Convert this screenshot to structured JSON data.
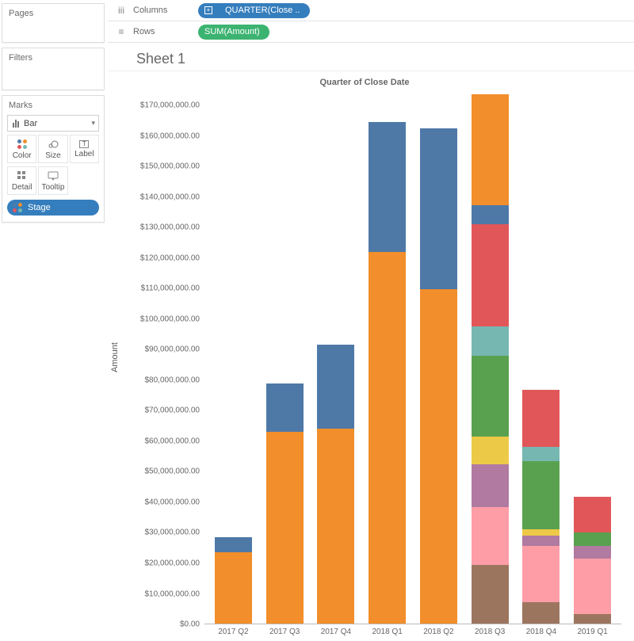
{
  "left": {
    "pages_title": "Pages",
    "filters_title": "Filters",
    "marks_title": "Marks",
    "mark_type": "Bar",
    "mark_cells": {
      "color": "Color",
      "size": "Size",
      "label": "Label",
      "detail": "Detail",
      "tooltip": "Tooltip"
    },
    "stage_pill": "Stage"
  },
  "shelves": {
    "columns_label": "Columns",
    "rows_label": "Rows",
    "column_pill": "QUARTER(Close ..",
    "row_pill": "SUM(Amount)"
  },
  "sheet_title": "Sheet 1",
  "chart_data": {
    "type": "bar",
    "stacked": true,
    "title": "Quarter of Close Date",
    "ylabel": "Amount",
    "ylim": [
      0,
      175000000
    ],
    "y_ticks": [
      "$170,000,000.00",
      "$160,000,000.00",
      "$150,000,000.00",
      "$140,000,000.00",
      "$130,000,000.00",
      "$120,000,000.00",
      "$110,000,000.00",
      "$100,000,000.00",
      "$90,000,000.00",
      "$80,000,000.00",
      "$70,000,000.00",
      "$60,000,000.00",
      "$50,000,000.00",
      "$40,000,000.00",
      "$30,000,000.00",
      "$20,000,000.00",
      "$10,000,000.00",
      "$0.00"
    ],
    "y_tick_values": [
      170000000,
      160000000,
      150000000,
      140000000,
      130000000,
      120000000,
      110000000,
      100000000,
      90000000,
      80000000,
      70000000,
      60000000,
      50000000,
      40000000,
      30000000,
      20000000,
      10000000,
      0
    ],
    "categories": [
      "2017 Q2",
      "2017 Q3",
      "2017 Q4",
      "2018 Q1",
      "2018 Q2",
      "2018 Q3",
      "2018 Q4",
      "2019 Q1"
    ],
    "colors": {
      "orange": "#f28e2b",
      "blue": "#4e79a7",
      "red": "#e15759",
      "teal": "#76b7b2",
      "green": "#59a14f",
      "yellow": "#edc948",
      "purple": "#b07aa1",
      "pink": "#ff9da7",
      "brown": "#9c755f"
    },
    "series_legend": [
      "orange",
      "blue",
      "red",
      "teal",
      "green",
      "yellow",
      "purple",
      "pink",
      "brown"
    ],
    "stacks": [
      [
        {
          "c": "orange",
          "v": 23000000
        },
        {
          "c": "blue",
          "v": 5000000
        }
      ],
      [
        {
          "c": "orange",
          "v": 62000000
        },
        {
          "c": "blue",
          "v": 15500000
        }
      ],
      [
        {
          "c": "orange",
          "v": 63000000
        },
        {
          "c": "blue",
          "v": 27000000
        }
      ],
      [
        {
          "c": "orange",
          "v": 120000000
        },
        {
          "c": "blue",
          "v": 42000000
        }
      ],
      [
        {
          "c": "orange",
          "v": 108000000
        },
        {
          "c": "blue",
          "v": 52000000
        }
      ],
      [
        {
          "c": "brown",
          "v": 19000000
        },
        {
          "c": "pink",
          "v": 18500000
        },
        {
          "c": "purple",
          "v": 14000000
        },
        {
          "c": "yellow",
          "v": 9000000
        },
        {
          "c": "green",
          "v": 26000000
        },
        {
          "c": "teal",
          "v": 9500000
        },
        {
          "c": "red",
          "v": 33000000
        },
        {
          "c": "blue",
          "v": 6000000
        },
        {
          "c": "orange",
          "v": 36000000
        }
      ],
      [
        {
          "c": "brown",
          "v": 7000000
        },
        {
          "c": "pink",
          "v": 18000000
        },
        {
          "c": "purple",
          "v": 3500000
        },
        {
          "c": "yellow",
          "v": 2000000
        },
        {
          "c": "green",
          "v": 22000000
        },
        {
          "c": "teal",
          "v": 4500000
        },
        {
          "c": "red",
          "v": 18500000
        }
      ],
      [
        {
          "c": "brown",
          "v": 3000000
        },
        {
          "c": "pink",
          "v": 18000000
        },
        {
          "c": "purple",
          "v": 4000000
        },
        {
          "c": "green",
          "v": 4500000
        },
        {
          "c": "red",
          "v": 11500000
        }
      ]
    ]
  }
}
